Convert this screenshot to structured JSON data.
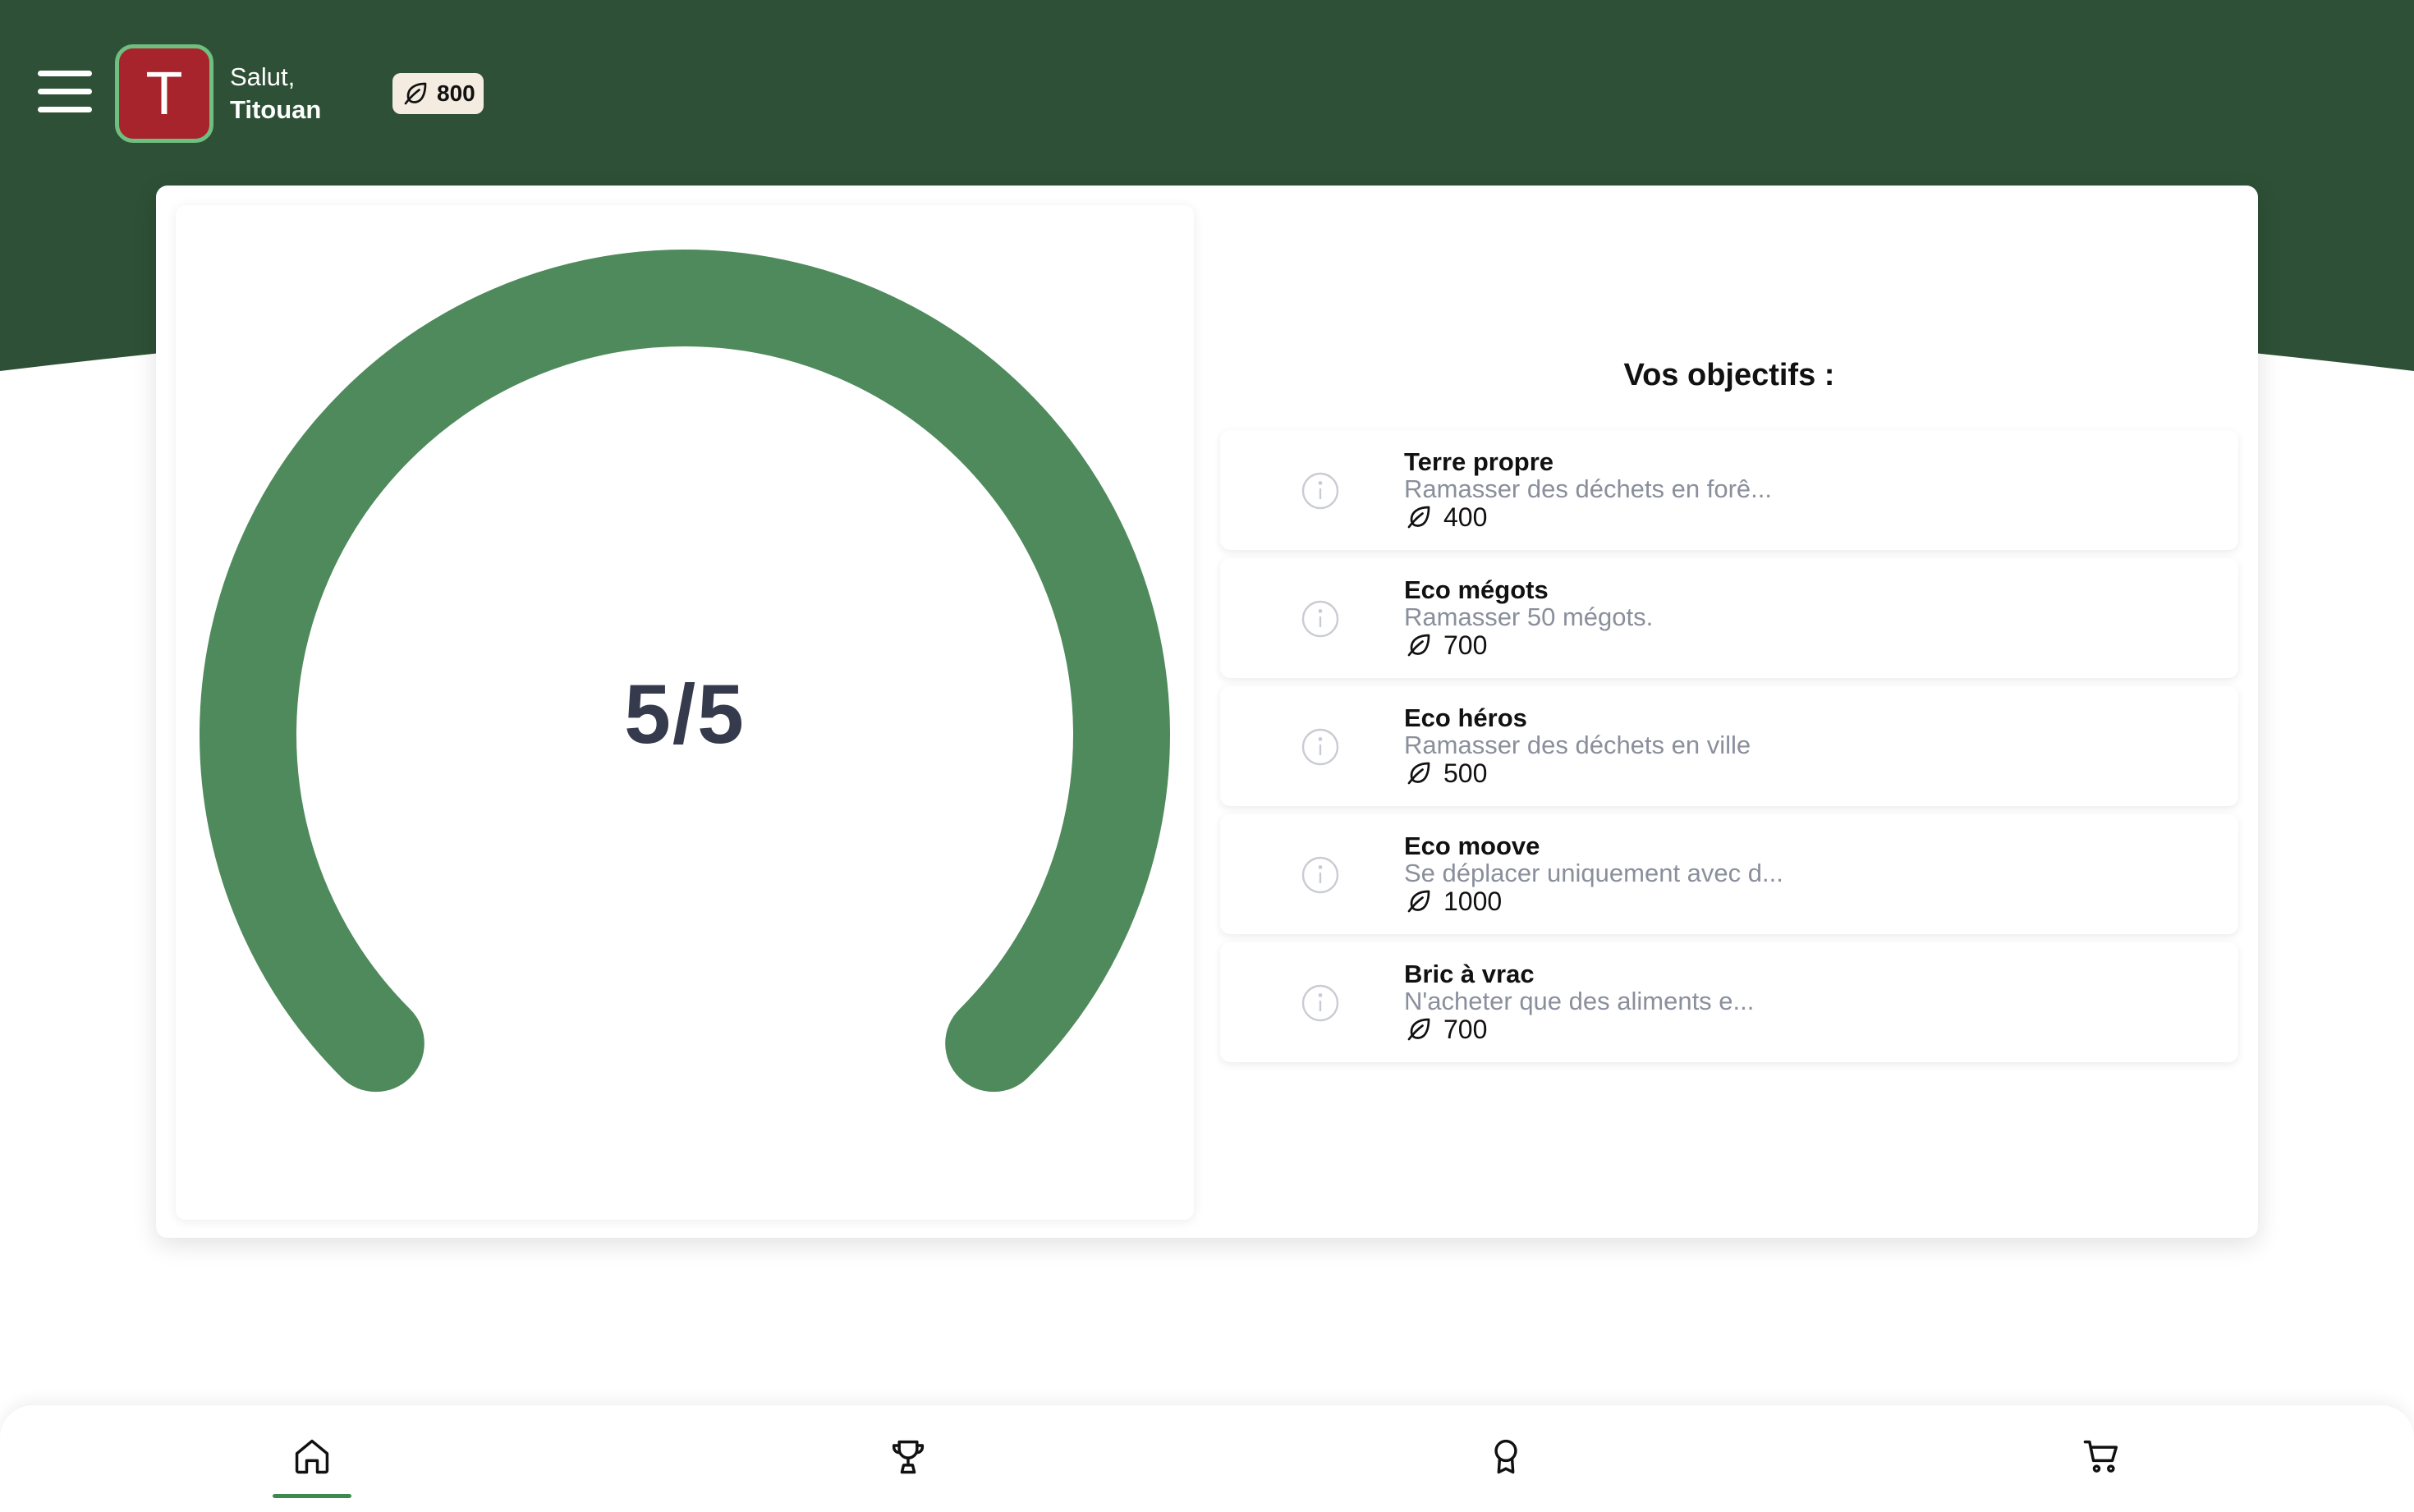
{
  "colors": {
    "header_bg": "#2d5036",
    "gauge": "#4e8a5b",
    "avatar_bg": "#a8242c",
    "avatar_border": "#6fbf80",
    "active_tab": "#3d8a4f"
  },
  "header": {
    "menu_icon": "hamburger-menu-icon",
    "avatar_letter": "T",
    "greeting": "Salut,",
    "user_name": "Titouan",
    "points": "800",
    "points_icon": "leaf-icon"
  },
  "progress": {
    "label": "5/5",
    "completed": 5,
    "total": 5
  },
  "goals": {
    "title": "Vos objectifs :",
    "items": [
      {
        "title": "Terre propre",
        "description": "Ramasser des déchets en forê...",
        "points": "400"
      },
      {
        "title": "Eco mégots",
        "description": "Ramasser 50 mégots.",
        "points": "700"
      },
      {
        "title": "Eco héros",
        "description": "Ramasser des déchets en ville",
        "points": "500"
      },
      {
        "title": "Eco moove",
        "description": "Se déplacer uniquement avec d...",
        "points": "1000"
      },
      {
        "title": "Bric à vrac",
        "description": "N'acheter que des aliments e...",
        "points": "700"
      }
    ]
  },
  "nav": {
    "active": "home",
    "items": [
      "home-icon",
      "trophy-icon",
      "award-icon",
      "cart-icon"
    ]
  }
}
